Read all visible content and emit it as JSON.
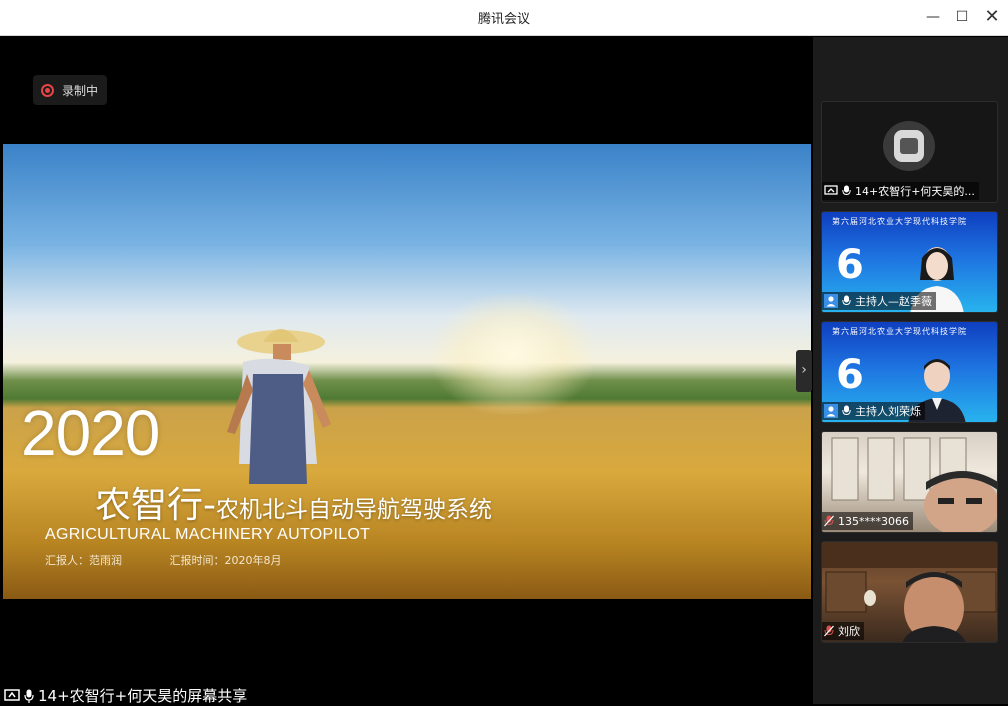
{
  "window": {
    "title": "腾讯会议",
    "controls": {
      "minimize": "—",
      "maximize": "☐",
      "close": "✕"
    }
  },
  "recording": {
    "label": "录制中"
  },
  "slide": {
    "year": "2020",
    "title_main": "农智行",
    "title_dash": "-",
    "title_rest": "农机北斗自动导航驾驶系统",
    "subtitle": "AGRICULTURAL MACHINERY AUTOPILOT",
    "presenter": "汇报人：范雨润",
    "date": "汇报时间：2020年8月"
  },
  "share_label": "14+农智行+何天昊的屏幕共享",
  "participants": [
    {
      "name": "14+农智行+何天昊的...",
      "icon": "screen-share-icon"
    },
    {
      "name": "主持人—赵季薇",
      "icon": "host-icon"
    },
    {
      "name": "主持人刘荣烁",
      "icon": "host-icon"
    },
    {
      "name": "135****3066",
      "icon": "mic-muted-icon"
    },
    {
      "name": "刘欣",
      "icon": "mic-muted-icon"
    }
  ],
  "colors": {
    "accent_red": "#e84444",
    "mute_red": "#d9534f",
    "host_blue": "#3a8ee6"
  }
}
